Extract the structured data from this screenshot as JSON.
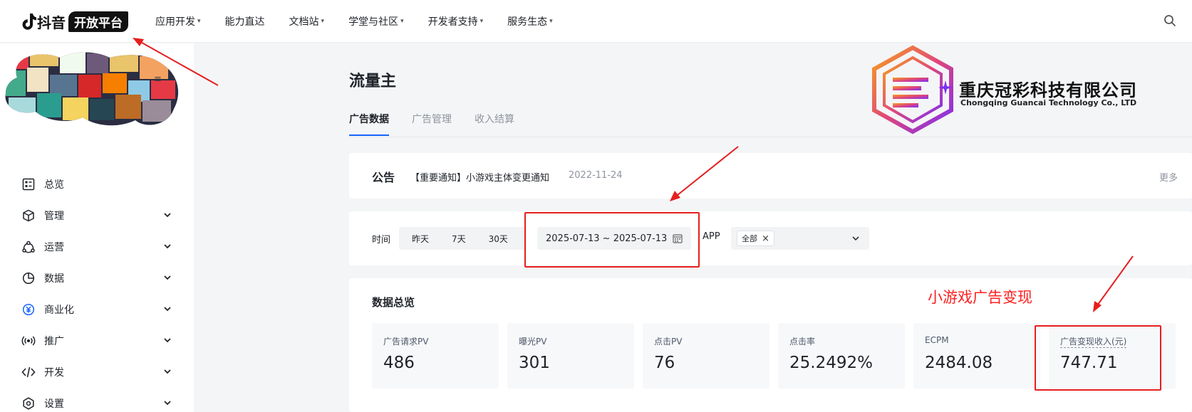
{
  "header": {
    "logo_text": "抖音",
    "logo_badge": "开放平台",
    "nav": [
      {
        "label": "应用开发",
        "has_caret": true
      },
      {
        "label": "能力直达",
        "has_caret": false
      },
      {
        "label": "文档站",
        "has_caret": true
      },
      {
        "label": "学堂与社区",
        "has_caret": true
      },
      {
        "label": "开发者支持",
        "has_caret": true
      },
      {
        "label": "服务生态",
        "has_caret": true
      }
    ],
    "search_icon": "search-icon"
  },
  "sidebar": {
    "items": [
      {
        "label": "总览",
        "icon": "overview-icon",
        "expandable": false
      },
      {
        "label": "管理",
        "icon": "cube-icon",
        "expandable": true
      },
      {
        "label": "运营",
        "icon": "operation-icon",
        "expandable": true
      },
      {
        "label": "数据",
        "icon": "pie-chart-icon",
        "expandable": true
      },
      {
        "label": "商业化",
        "icon": "yuan-coin-icon",
        "expandable": true
      },
      {
        "label": "推广",
        "icon": "broadcast-icon",
        "expandable": true
      },
      {
        "label": "开发",
        "icon": "code-icon",
        "expandable": true
      },
      {
        "label": "设置",
        "icon": "settings-icon",
        "expandable": true
      }
    ]
  },
  "main": {
    "title": "流量主",
    "tabs": [
      {
        "label": "广告数据",
        "active": true
      },
      {
        "label": "广告管理",
        "active": false
      },
      {
        "label": "收入结算",
        "active": false
      }
    ],
    "company": {
      "name_cn": "重庆冠彩科技有限公司",
      "name_en": "Chongqing Guancai Technology Co., LTD"
    },
    "notice": {
      "label": "公告",
      "link": "【重要通知】小游戏主体变更通知",
      "date": "2022-11-24",
      "more": "更多"
    },
    "filter": {
      "time_label": "时间",
      "quick_ranges": [
        "昨天",
        "7天",
        "30天"
      ],
      "date_range": "2025-07-13 ~ 2025-07-13",
      "app_label": "APP",
      "app_selected": "全部"
    },
    "overview": {
      "title": "数据总览",
      "metrics": [
        {
          "label": "广告请求PV",
          "value": "486"
        },
        {
          "label": "曝光PV",
          "value": "301"
        },
        {
          "label": "点击PV",
          "value": "76"
        },
        {
          "label": "点击率",
          "value": "25.2492%"
        },
        {
          "label": "ECPM",
          "value": "2484.08"
        },
        {
          "label": "广告变现收入(元)",
          "value": "747.71"
        }
      ]
    }
  },
  "annotation": {
    "text": "小游戏广告变现",
    "color": "#ff1f1f"
  },
  "colors": {
    "accent": "#1664ff",
    "annotation_red": "#e61e1e"
  }
}
